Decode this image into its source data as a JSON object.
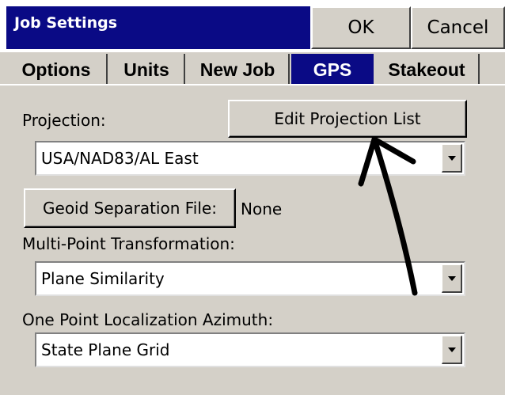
{
  "window": {
    "title": "Job Settings",
    "ok_label": "OK",
    "cancel_label": "Cancel",
    "title_color": "#0a0a85",
    "face_color": "#d4d0c8"
  },
  "tabs": [
    {
      "label": "Options",
      "active": false
    },
    {
      "label": "Units",
      "active": false
    },
    {
      "label": "New Job",
      "active": false
    },
    {
      "label": "GPS",
      "active": true
    },
    {
      "label": "Stakeout",
      "active": false
    }
  ],
  "gps": {
    "projection_label": "Projection:",
    "edit_projection_button": "Edit Projection List",
    "projection_value": "USA/NAD83/AL East",
    "geoid_button": "Geoid Separation File:",
    "geoid_value": "None",
    "transformation_label": "Multi-Point Transformation:",
    "transformation_value": "Plane Similarity",
    "azimuth_label": "One Point Localization Azimuth:",
    "azimuth_value": "State Plane Grid"
  },
  "icons": {
    "dropdown": "chevron-down-icon",
    "annotation": "arrow-annotation"
  }
}
